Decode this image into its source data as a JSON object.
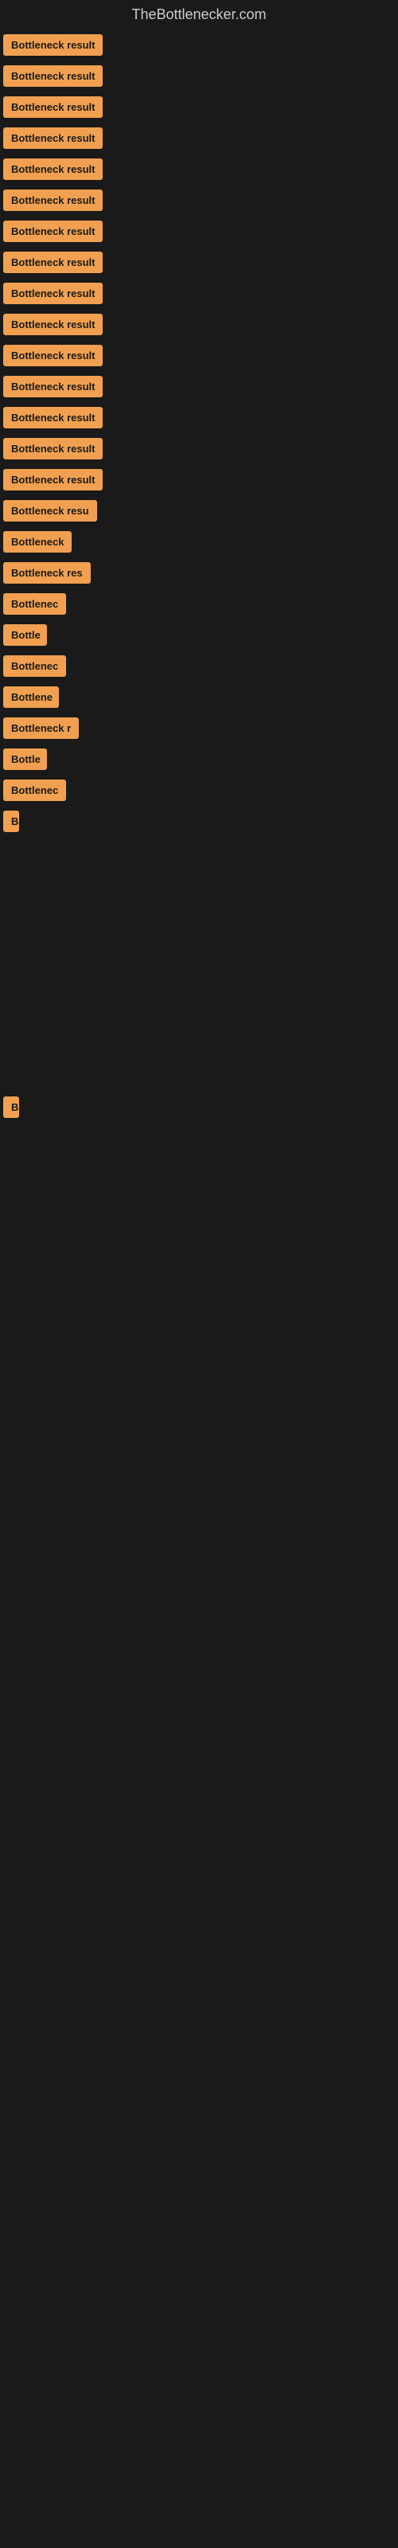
{
  "site": {
    "title": "TheBottlenecker.com"
  },
  "items": [
    {
      "label": "Bottleneck result",
      "width": 145
    },
    {
      "label": "Bottleneck result",
      "width": 145
    },
    {
      "label": "Bottleneck result",
      "width": 145
    },
    {
      "label": "Bottleneck result",
      "width": 145
    },
    {
      "label": "Bottleneck result",
      "width": 145
    },
    {
      "label": "Bottleneck result",
      "width": 145
    },
    {
      "label": "Bottleneck result",
      "width": 145
    },
    {
      "label": "Bottleneck result",
      "width": 145
    },
    {
      "label": "Bottleneck result",
      "width": 145
    },
    {
      "label": "Bottleneck result",
      "width": 145
    },
    {
      "label": "Bottleneck result",
      "width": 145
    },
    {
      "label": "Bottleneck result",
      "width": 145
    },
    {
      "label": "Bottleneck result",
      "width": 145
    },
    {
      "label": "Bottleneck result",
      "width": 145
    },
    {
      "label": "Bottleneck result",
      "width": 145
    },
    {
      "label": "Bottleneck resu",
      "width": 120
    },
    {
      "label": "Bottleneck",
      "width": 90
    },
    {
      "label": "Bottleneck res",
      "width": 110
    },
    {
      "label": "Bottlenec",
      "width": 80
    },
    {
      "label": "Bottle",
      "width": 55
    },
    {
      "label": "Bottlenec",
      "width": 80
    },
    {
      "label": "Bottlene",
      "width": 70
    },
    {
      "label": "Bottleneck r",
      "width": 95
    },
    {
      "label": "Bottle",
      "width": 55
    },
    {
      "label": "Bottlenec",
      "width": 80
    },
    {
      "label": "B",
      "width": 20
    },
    {
      "label": "",
      "width": 0
    },
    {
      "label": "",
      "width": 0
    },
    {
      "label": "",
      "width": 0
    },
    {
      "label": "",
      "width": 0
    },
    {
      "label": "B",
      "width": 20
    },
    {
      "label": "",
      "width": 0
    },
    {
      "label": "",
      "width": 0
    },
    {
      "label": "",
      "width": 0
    },
    {
      "label": "",
      "width": 0
    },
    {
      "label": "",
      "width": 0
    }
  ]
}
